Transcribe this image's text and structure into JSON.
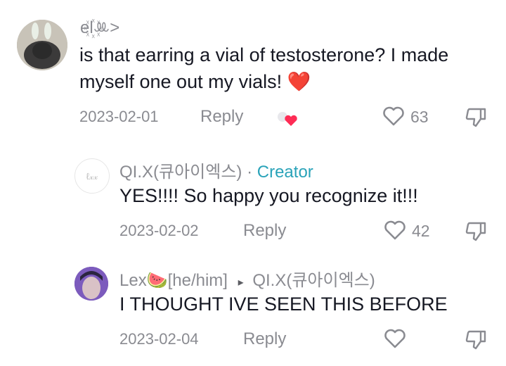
{
  "comments": [
    {
      "username": "el꙰ꔛ>",
      "text": "is that earring a vial of testosterone? I made myself one out my vials! ❤️",
      "date": "2023-02-01",
      "reply_label": "Reply",
      "likes": "63"
    },
    {
      "username": "QI.X(큐아이엑스)",
      "separator": "·",
      "badge": "Creator",
      "text": "YES!!!! So happy you recognize it!!!",
      "date": "2023-02-02",
      "reply_label": "Reply",
      "likes": "42"
    },
    {
      "username": "Lex🍉[he/him]",
      "reply_to": "QI.X(큐아이엑스)",
      "text": "I THOUGHT IVE SEEN THIS BEFORE",
      "date": "2023-02-04",
      "reply_label": "Reply",
      "likes": ""
    }
  ],
  "colors": {
    "text": "#161823",
    "muted": "#8a8b91",
    "creator": "#2aa3b9",
    "heart_red": "#fe2c55"
  }
}
